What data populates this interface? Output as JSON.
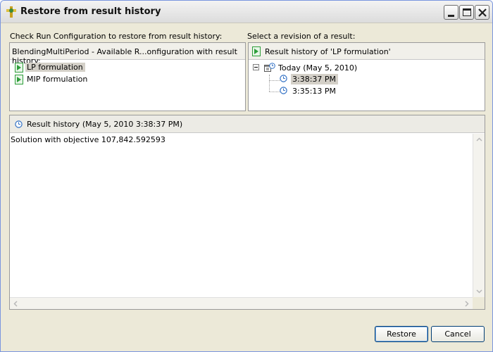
{
  "window": {
    "title": "Restore from result history"
  },
  "left": {
    "label": "Check Run Configuration to restore from result history:",
    "header": "BlendingMultiPeriod - Available R...onfiguration with result history:",
    "items": [
      {
        "label": "LP formulation",
        "selected": true,
        "icon": "run-config-icon"
      },
      {
        "label": "MIP formulation",
        "selected": false,
        "icon": "run-config-icon"
      }
    ]
  },
  "right": {
    "label": "Select a revision of a result:",
    "header": "Result history of 'LP formulation'",
    "tree": {
      "group_label": "Today (May 5, 2010)",
      "expanded": true,
      "revisions": [
        {
          "label": "3:38:37 PM",
          "selected": true,
          "icon": "clock-icon"
        },
        {
          "label": "3:35:13 PM",
          "selected": false,
          "icon": "clock-icon"
        }
      ]
    }
  },
  "result": {
    "header": "Result history (May 5, 2010 3:38:37 PM)",
    "text": "Solution with objective 107,842.592593"
  },
  "buttons": {
    "restore": "Restore",
    "cancel": "Cancel"
  },
  "colors": {
    "dialog_bg": "#ece9d8",
    "selection_bg": "#d4d0c8",
    "button_border": "#003c74",
    "run_icon_green": "#2e9e3a",
    "clock_blue": "#2f6fc4"
  }
}
